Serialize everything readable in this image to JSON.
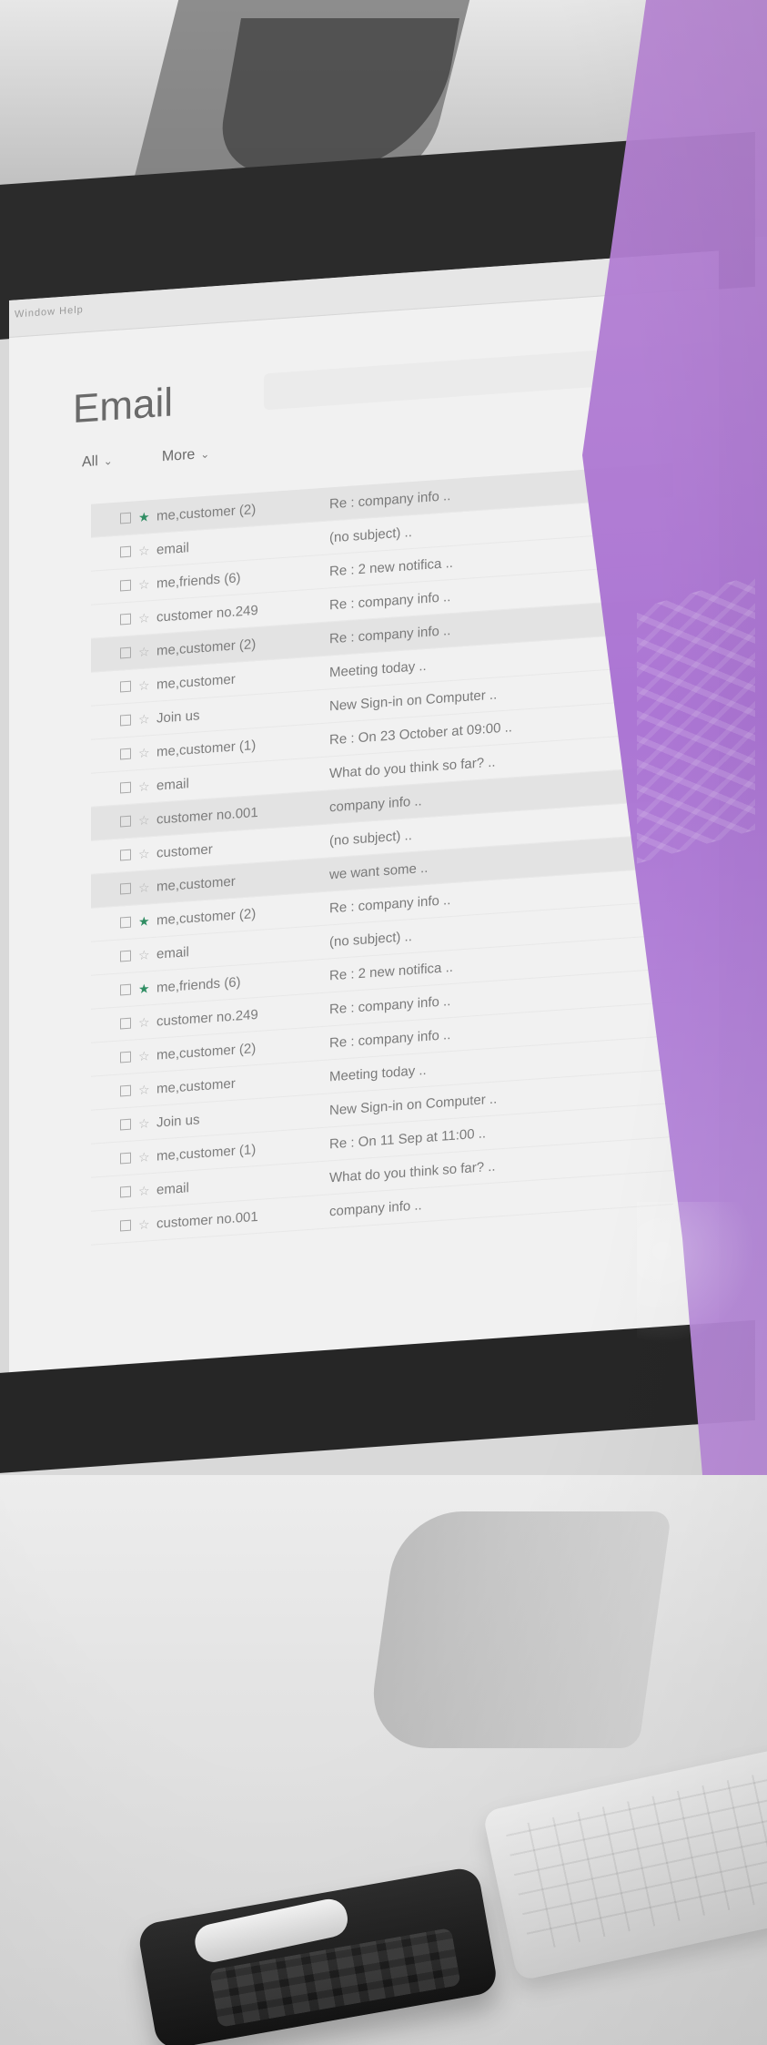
{
  "app": {
    "menu_label": "Window  Help",
    "title": "Email",
    "toolbar": [
      {
        "label": "All",
        "has_dropdown": true
      },
      {
        "label": "More",
        "has_dropdown": true
      }
    ]
  },
  "emails": [
    {
      "starred": true,
      "sender": "me,customer (2)",
      "subject": "Re : company info ..",
      "shaded": true
    },
    {
      "starred": false,
      "sender": "email",
      "subject": "(no subject) ..",
      "shaded": false
    },
    {
      "starred": false,
      "sender": "me,friends (6)",
      "subject": "Re : 2 new notifica ..",
      "shaded": false
    },
    {
      "starred": false,
      "sender": "customer no.249",
      "subject": "Re : company info ..",
      "shaded": false
    },
    {
      "starred": false,
      "sender": "me,customer (2)",
      "subject": "Re : company info ..",
      "shaded": true
    },
    {
      "starred": false,
      "sender": "me,customer",
      "subject": "Meeting today ..",
      "shaded": false
    },
    {
      "starred": false,
      "sender": "Join us",
      "subject": "New Sign-in on Computer ..",
      "shaded": false
    },
    {
      "starred": false,
      "sender": "me,customer (1)",
      "subject": "Re : On 23 October at 09:00 ..",
      "shaded": false
    },
    {
      "starred": false,
      "sender": "email",
      "subject": "What do you think so far? ..",
      "shaded": false
    },
    {
      "starred": false,
      "sender": "customer no.001",
      "subject": "company info ..",
      "shaded": true
    },
    {
      "starred": false,
      "sender": "customer",
      "subject": "(no subject) ..",
      "shaded": false
    },
    {
      "starred": false,
      "sender": "me,customer",
      "subject": "we want some ..",
      "shaded": true
    },
    {
      "starred": true,
      "sender": "me,customer (2)",
      "subject": "Re : company info ..",
      "shaded": false
    },
    {
      "starred": false,
      "sender": "email",
      "subject": "(no subject) ..",
      "shaded": false
    },
    {
      "starred": true,
      "sender": "me,friends (6)",
      "subject": "Re : 2 new notifica ..",
      "shaded": false
    },
    {
      "starred": false,
      "sender": "customer no.249",
      "subject": "Re : company info ..",
      "shaded": false
    },
    {
      "starred": false,
      "sender": "me,customer (2)",
      "subject": "Re : company info ..",
      "shaded": false
    },
    {
      "starred": false,
      "sender": "me,customer",
      "subject": "Meeting today ..",
      "shaded": false
    },
    {
      "starred": false,
      "sender": "Join us",
      "subject": "New Sign-in on Computer ..",
      "shaded": false
    },
    {
      "starred": false,
      "sender": "me,customer (1)",
      "subject": "Re : On 11 Sep at 11:00 ..",
      "shaded": false
    },
    {
      "starred": false,
      "sender": "email",
      "subject": "What do you think so far? ..",
      "shaded": false
    },
    {
      "starred": false,
      "sender": "customer no.001",
      "subject": "company info ..",
      "shaded": false
    }
  ],
  "colors": {
    "purple_overlay": "#b887d3",
    "star_green": "#2f8d63"
  },
  "icons": {
    "star": "star-icon",
    "checkbox": "checkbox-icon",
    "chevron": "chevron-down-icon"
  }
}
